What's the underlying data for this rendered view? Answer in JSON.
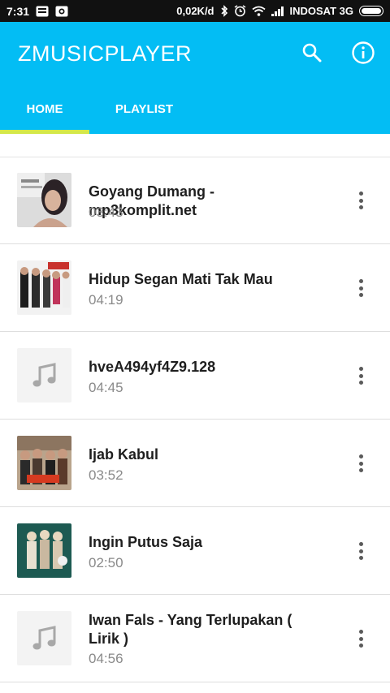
{
  "status_bar": {
    "time": "7:31",
    "speed": "0,02K/d",
    "carrier": "INDOSAT 3G"
  },
  "app_bar": {
    "title": "ZMUSICPLAYER",
    "icons": [
      "search-icon",
      "info-icon"
    ],
    "accent_color": "#03bdf4",
    "indicator_color": "#d4e84a"
  },
  "tabs": [
    {
      "label": "HOME",
      "selected": true
    },
    {
      "label": "PLAYLIST",
      "selected": false
    }
  ],
  "songs": [
    {
      "title": "Goyang Dumang - mp3komplit.net",
      "duration": "03:43",
      "thumb": "album-art"
    },
    {
      "title": "Hidup Segan Mati Tak Mau",
      "duration": "04:19",
      "thumb": "album-art"
    },
    {
      "title": "hveA494yf4Z9.128",
      "duration": "04:45",
      "thumb": "music-note-icon"
    },
    {
      "title": "Ijab Kabul",
      "duration": "03:52",
      "thumb": "album-art"
    },
    {
      "title": "Ingin Putus Saja",
      "duration": "02:50",
      "thumb": "album-art"
    },
    {
      "title": "Iwan Fals  - Yang Terlupakan ( Lirik )",
      "duration": "04:56",
      "thumb": "music-note-icon"
    }
  ]
}
